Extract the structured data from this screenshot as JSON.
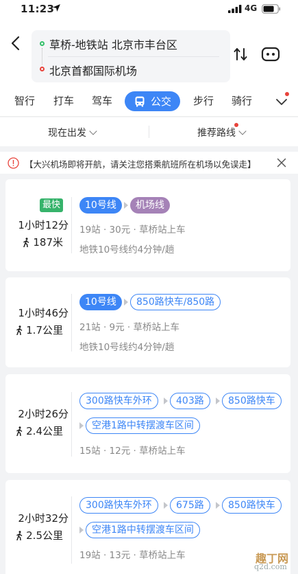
{
  "status_bar": {
    "time": "11:23",
    "network": "4G"
  },
  "route": {
    "origin": "草桥-地铁站 北京市丰台区",
    "destination": "北京首都国际机场"
  },
  "modes": {
    "items": [
      "智行",
      "打车",
      "驾车",
      "公交",
      "步行",
      "骑行"
    ],
    "active": "公交"
  },
  "filters": {
    "depart": "现在出发",
    "sort": "推荐路线"
  },
  "notice": {
    "text": "【大兴机场即将开航，请关注您搭乘航班所在机场以免误走】"
  },
  "colors": {
    "accent": "#3d86f6",
    "fastest": "#36b36b",
    "airport_line": "#a582b7",
    "alert": "#e8433b"
  },
  "routes": [
    {
      "badge": "最快",
      "duration": "1小时12分",
      "walk": "187米",
      "lines": [
        "10号线",
        "机场线"
      ],
      "info": "19站 · 30元 · 草桥站上车",
      "frequency": "地铁10号线约4分钟/趟"
    },
    {
      "duration": "1小时46分",
      "walk": "1.7公里",
      "lines": [
        "10号线",
        "850路快车/850路"
      ],
      "info": "21站 · 9元 · 草桥站上车",
      "frequency": "地铁10号线约4分钟/趟"
    },
    {
      "duration": "2小时26分",
      "walk": "2.4公里",
      "lines": [
        "300路快车外环",
        "403路",
        "850路快车",
        "空港1路中转摆渡车区间"
      ],
      "info": "15站 · 12元 · 草桥站上车"
    },
    {
      "duration": "2小时32分",
      "walk": "2.5公里",
      "lines": [
        "300路快车外环",
        "675路",
        "850路快车",
        "空港1路中转摆渡车区间"
      ],
      "info": "19站 · 13元 · 草桥站上车"
    }
  ],
  "watermark": {
    "top": "趣丁网",
    "bottom": "q2d.com"
  }
}
